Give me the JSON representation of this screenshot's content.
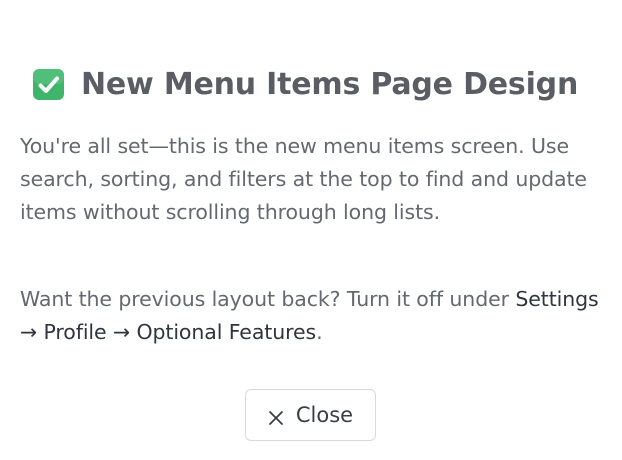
{
  "dialog": {
    "title_icon": "check-mark-icon",
    "title": "New Menu Items Page Design",
    "paragraph1": "You're all set—this is the new menu items screen. Use search, sorting, and filters at the top to find and update items without scrolling through long lists.",
    "paragraph2_prefix": "Want the previous layout back? Turn it off under ",
    "paragraph2_path": "Settings → Profile → Optional Features",
    "paragraph2_suffix": ".",
    "close_icon": "close-icon",
    "close_label": "Close"
  },
  "colors": {
    "check_green": "#3fb56b",
    "title_text": "#5a5d63",
    "body_text": "#646870",
    "emphasis_text": "#2f3540",
    "button_border": "#d7d9dd"
  }
}
